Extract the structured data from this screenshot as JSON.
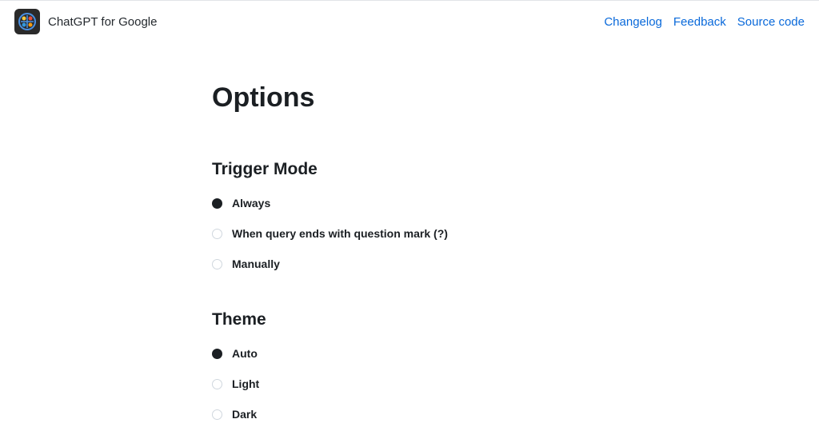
{
  "header": {
    "title": "ChatGPT for Google",
    "links": {
      "changelog": "Changelog",
      "feedback": "Feedback",
      "source": "Source code"
    }
  },
  "page": {
    "title": "Options"
  },
  "sections": {
    "trigger_mode": {
      "title": "Trigger Mode",
      "options": {
        "always": "Always",
        "question": "When query ends with question mark (?)",
        "manually": "Manually"
      },
      "selected": "always"
    },
    "theme": {
      "title": "Theme",
      "options": {
        "auto": "Auto",
        "light": "Light",
        "dark": "Dark"
      },
      "selected": "auto"
    }
  }
}
